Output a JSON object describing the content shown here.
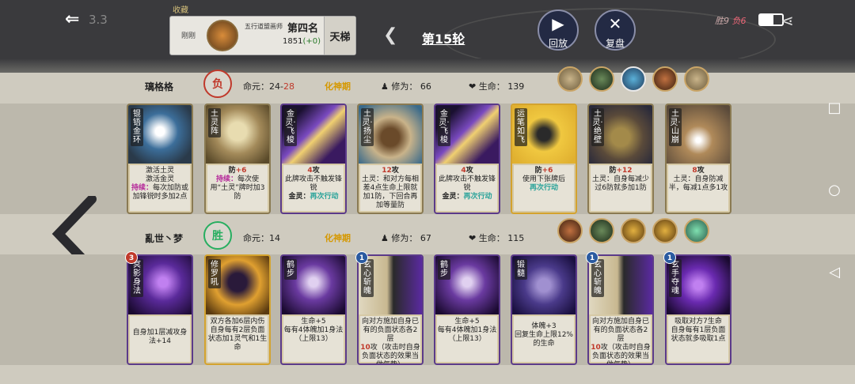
{
  "header": {
    "back_icon": "back-arrow-icon",
    "back_hint": "3.3",
    "collect_label": "收藏",
    "player_name": "刚刚",
    "player_title": "五行道盟画师",
    "rank": "第四名",
    "score": "1851",
    "score_delta": "(+0)",
    "ladder_label": "天梯",
    "round": "第15轮",
    "replay_label": "回放",
    "review_label": "复盘",
    "wins": "胜9",
    "losses": "负6"
  },
  "top": {
    "name": "璃格格",
    "result": "负",
    "life_label": "命元：",
    "life_a": "24",
    "life_sep": "-",
    "life_b": "28",
    "realm": "化神期",
    "cultivation_label": "修为：",
    "cultivation": "66",
    "hp_label": "生命：",
    "hp": "139",
    "cards": [
      {
        "name": "锟铻金环",
        "l1": "激活土灵",
        "l2": "激活金灵",
        "l3k": "持续：",
        "l3": "每次加防或加锋锐时多加2点",
        "l4": ""
      },
      {
        "name": "土灵阵",
        "l1": "防",
        "l1v": "+6",
        "l2k": "持续：",
        "l2": "每次使用“土灵”牌时加3防",
        "l3": "",
        "l4": ""
      },
      {
        "name": "金灵·飞梭",
        "l1v": "4",
        "l1": "攻",
        "l2": "此牌攻击不触发锋锐",
        "l3k": "金灵：",
        "l3": "再次行动",
        "l4": ""
      },
      {
        "name": "土灵·扬尘",
        "l1v": "12",
        "l1": "攻",
        "l2": "土灵：和对方每相差4点生命上限就加1防，下回合再加等量防",
        "l3": "",
        "l4": ""
      },
      {
        "name": "金灵·飞梭",
        "l1v": "4",
        "l1": "攻",
        "l2": "此牌攻击不触发锋锐",
        "l3k": "金灵：",
        "l3": "再次行动",
        "l4": ""
      },
      {
        "name": "运笔如飞",
        "l1": "防",
        "l1v": "+6",
        "l2": "使用下张牌后",
        "l3": "再次行动",
        "l4": ""
      },
      {
        "name": "土灵·绝壁",
        "l1": "防",
        "l1v": "+12",
        "l2": "土灵：自身每减少过6防就多加1防",
        "l3": "",
        "l4": ""
      },
      {
        "name": "土灵·山崩",
        "l1v": "8",
        "l1": "攻",
        "l2": "土灵：自身防减半，每减1点多1攻",
        "l3": "",
        "l4": ""
      }
    ]
  },
  "bottom": {
    "name": "亂世丶梦",
    "result": "胜",
    "life_label": "命元：",
    "life": "14",
    "realm": "化神期",
    "cultivation_label": "修为：",
    "cultivation": "67",
    "hp_label": "生命：",
    "hp": "115",
    "cards": [
      {
        "name": "冥影身法",
        "badge": "3",
        "l1": "自身加1层减攻身法+14",
        "l2": ""
      },
      {
        "name": "修罗吼",
        "l1": "双方各加6层内伤",
        "l2": "自身每有2层负面状态加1灵气和1生命"
      },
      {
        "name": "鹤步",
        "l1": "生命+5",
        "l2": "每有4体魄加1身法（上限13）"
      },
      {
        "name": "玄心斩魄",
        "badge": "1",
        "l1": "向对方施加自身已有的负面状态各2层",
        "l2v": "10",
        "l2": "攻（攻击时自身负面状态的效果当做气势）"
      },
      {
        "name": "鹤步",
        "l1": "生命+5",
        "l2": "每有4体魄加1身法（上限13）"
      },
      {
        "name": "锻髓",
        "l1": "体魄+3",
        "l2": "回复生命上限12%的生命"
      },
      {
        "name": "玄心斩魄",
        "badge": "1",
        "l1": "向对方施加自身已有的负面状态各2层",
        "l2v": "10",
        "l2": "攻（攻击时自身负面状态的效果当做气势）"
      },
      {
        "name": "玄手夺魂",
        "badge": "1",
        "l1": "吸取对方7生命",
        "l2": "自身每有1层负面状态就多吸取1点"
      }
    ]
  },
  "icons": [
    "back-arrow-icon",
    "play-icon",
    "crossed-swords-icon",
    "battery-icon",
    "share-icon",
    "person-icon",
    "heart-icon",
    "left-arrow-icon",
    "square-icon",
    "circle-icon",
    "triangle-icon"
  ],
  "colors": {
    "lose": "#c0392b",
    "win": "#27ae60",
    "realm": "#d59800",
    "gold_frame": "#d4a32e",
    "purple_frame": "#5b3a8a"
  }
}
